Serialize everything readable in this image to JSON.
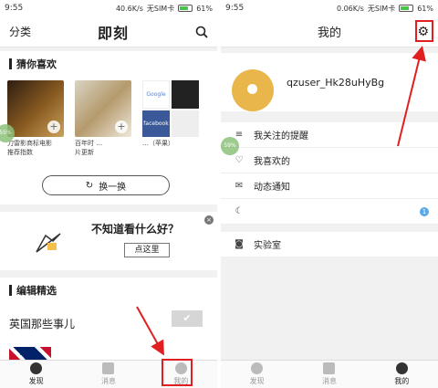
{
  "left": {
    "status": {
      "time": "9:55",
      "speed": "40.6K/s",
      "sim": "无SIM卡",
      "battery": "61%"
    },
    "topbar": {
      "category": "分类",
      "logo": "即刻"
    },
    "guess": {
      "heading": "猜你喜欢",
      "items": [
        {
          "caption": "刀雷影商标电影\n推荐指数"
        },
        {
          "caption": "百年时 …\n片更新"
        },
        {
          "caption": "…（苹果）",
          "logos": [
            "Google",
            "",
            "facebook",
            ""
          ]
        }
      ],
      "refresh_label": "换一换",
      "float_pct": "55%"
    },
    "ad": {
      "question": "不知道看什么好？",
      "button": "点这里"
    },
    "editor": {
      "heading": "编辑精选",
      "title": "英国那些事儿"
    },
    "tabs": [
      {
        "label": "发现"
      },
      {
        "label": "消息"
      },
      {
        "label": "我的"
      }
    ]
  },
  "right": {
    "status": {
      "time": "9:55",
      "speed": "0.06K/s",
      "sim": "无SIM卡",
      "battery": "61%"
    },
    "title": "我的",
    "username": "qzuser_Hk28uHyBg",
    "float_pct": "59%",
    "menu": [
      {
        "icon": "≡",
        "label": "我关注的提醒"
      },
      {
        "icon": "♡",
        "label": "我喜欢的"
      },
      {
        "icon": "✉",
        "label": "动态通知"
      },
      {
        "icon": "☾",
        "label": "",
        "badge": "1"
      }
    ],
    "menu2": [
      {
        "icon": "◙",
        "label": "实验室"
      }
    ],
    "tabs": [
      {
        "label": "发现"
      },
      {
        "label": "消息"
      },
      {
        "label": "我的"
      }
    ]
  }
}
